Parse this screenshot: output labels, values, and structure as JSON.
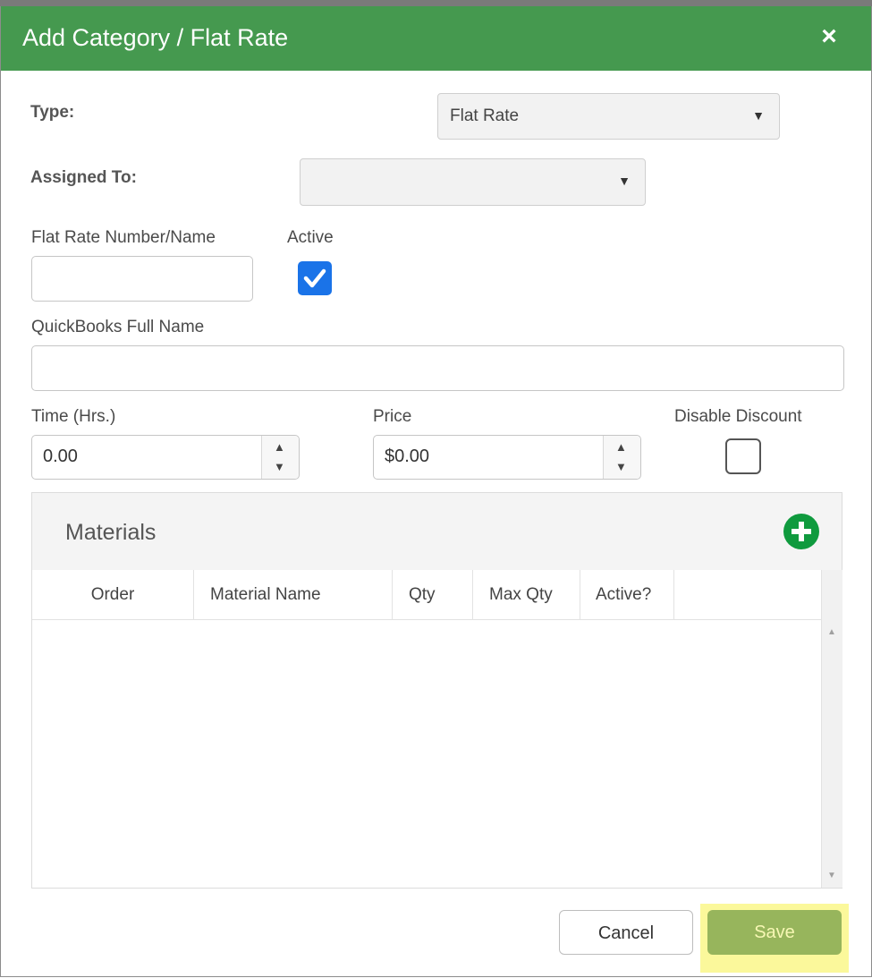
{
  "dialog": {
    "title": "Add Category / Flat Rate",
    "close_glyph": "×"
  },
  "form": {
    "type_label": "Type:",
    "type_value": "Flat Rate",
    "assigned_label": "Assigned To:",
    "assigned_value": "",
    "flat_rate_label": "Flat Rate Number/Name",
    "flat_rate_value": "",
    "active_label": "Active",
    "active_checked": true,
    "qb_label": "QuickBooks Full Name",
    "qb_value": "",
    "time_label": "Time (Hrs.)",
    "time_value": "0.00",
    "price_label": "Price",
    "price_value": "$0.00",
    "disable_discount_label": "Disable Discount",
    "disable_discount_checked": false
  },
  "materials": {
    "title": "Materials",
    "columns": [
      "Order",
      "Material Name",
      "Qty",
      "Max Qty",
      "Active?"
    ],
    "rows": []
  },
  "buttons": {
    "cancel": "Cancel",
    "save": "Save"
  },
  "icons": {
    "dropdown": "chevron-down-icon",
    "add": "plus-circle-icon",
    "check": "check-icon",
    "close": "close-icon"
  },
  "colors": {
    "header": "#45994f",
    "checkbox": "#1a73e8",
    "add_button": "#0f9a3e",
    "save_button": "#97b55c",
    "save_highlight": "#fbf89b"
  }
}
